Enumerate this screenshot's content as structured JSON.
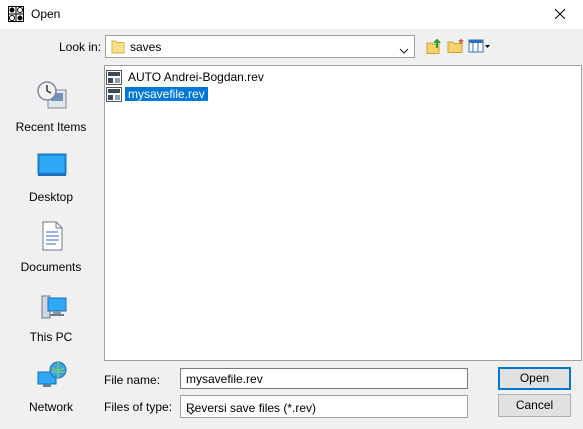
{
  "window": {
    "title": "Open",
    "icon": "reversi-board-icon",
    "close_icon": "close-icon"
  },
  "toolbar": {
    "lookin_label": "Look in:",
    "lookin_value": "saves",
    "up_icon": "up-folder-icon",
    "new_folder_icon": "new-folder-icon",
    "view_icon": "view-menu-icon"
  },
  "places": [
    {
      "label": "Recent Items",
      "icon": "recent-items-icon"
    },
    {
      "label": "Desktop",
      "icon": "desktop-icon"
    },
    {
      "label": "Documents",
      "icon": "documents-icon"
    },
    {
      "label": "This PC",
      "icon": "this-pc-icon"
    },
    {
      "label": "Network",
      "icon": "network-icon"
    }
  ],
  "files": [
    {
      "name": "AUTO Andrei-Bogdan.rev",
      "selected": false
    },
    {
      "name": "mysavefile.rev",
      "selected": true
    }
  ],
  "form": {
    "file_name_label": "File name:",
    "file_name_value": "mysavefile.rev",
    "file_type_label": "Files of type:",
    "file_type_value": "Reversi save files (*.rev)"
  },
  "buttons": {
    "open": "Open",
    "cancel": "Cancel"
  },
  "colors": {
    "selection": "#0078d7",
    "background": "#f0f0f0"
  }
}
